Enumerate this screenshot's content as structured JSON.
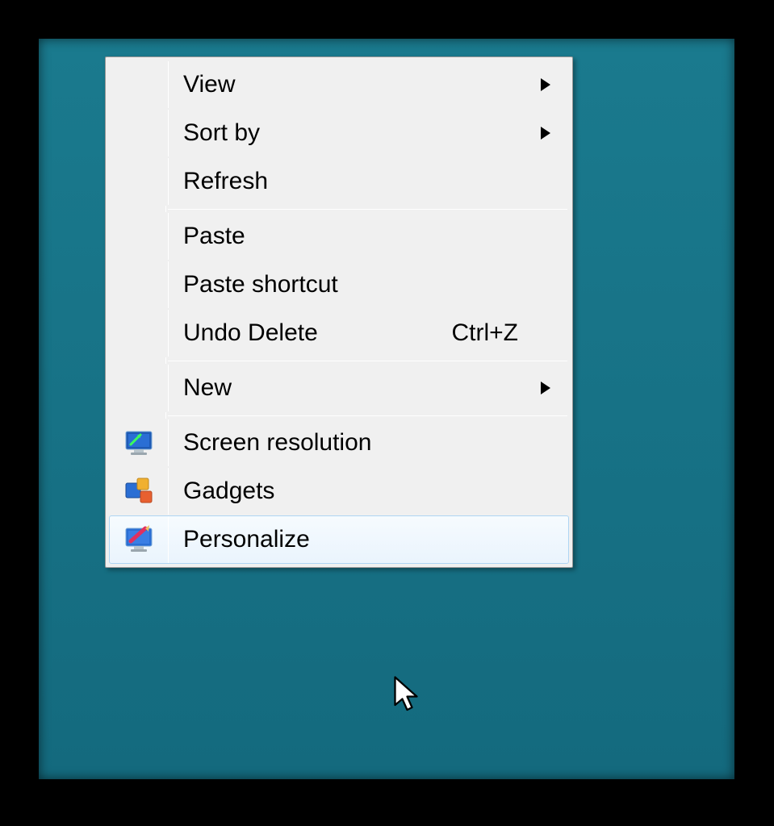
{
  "context_menu": {
    "items": [
      {
        "label": "View",
        "has_submenu": true
      },
      {
        "label": "Sort by",
        "has_submenu": true
      },
      {
        "label": "Refresh"
      },
      {
        "separator": true
      },
      {
        "label": "Paste"
      },
      {
        "label": "Paste shortcut"
      },
      {
        "label": "Undo Delete",
        "shortcut": "Ctrl+Z"
      },
      {
        "separator": true
      },
      {
        "label": "New",
        "has_submenu": true
      },
      {
        "separator": true
      },
      {
        "label": "Screen resolution",
        "icon": "screen-resolution-icon"
      },
      {
        "label": "Gadgets",
        "icon": "gadgets-icon"
      },
      {
        "label": "Personalize",
        "icon": "personalize-icon",
        "selected": true
      }
    ]
  }
}
